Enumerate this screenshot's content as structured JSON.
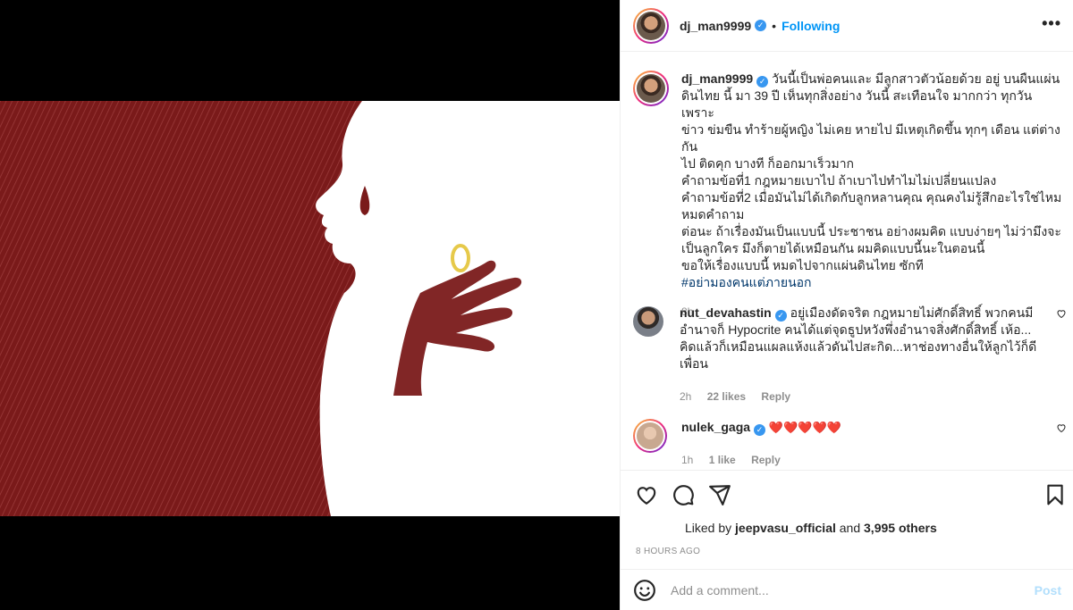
{
  "post": {
    "author": "dj_man9999",
    "follow_status": "Following",
    "more_icon": "more-options-icon",
    "caption": "วันนี้เป็นพ่อคนและ มีลูกสาวตัวน้อยด้วย อยู่ บนผืนแผ่น\nดินไทย นี้ มา 39 ปี เห็นทุกสิ่งอย่าง วันนี้ สะเทือนใจ มากกว่า ทุกวัน เพราะ\nข่าว ข่มขืน ทำร้ายผู้หญิง ไม่เคย หายไป มีเหตุเกิดขึ้น ทุกๆ เดือน แต่ต่างกัน\nไป ติดคุก บางที ก็ออกมาเร็วมาก\nคำถามข้อที่1 กฎหมายเบาไป ถ้าเบาไปทำไมไม่เปลี่ยนแปลง\nคำถามข้อที่2 เมื่อมันไม่ได้เกิดกับลูกหลานคุณ คุณคงไม่รู้สึกอะไรใช่ไหม\nหมดคำถาม\nต่อนะ ถ้าเรื่องมันเป็นแบบนี้ ประชาชน อย่างผมคิด แบบง่ายๆ ไม่ว่ามึงจะ\nเป็นลูกใคร มึงก็ตายได้เหมือนกัน ผมคิดแบบนี้นะในตอนนี้\nขอให้เรื่องแบบนี้ หมดไปจากแผ่นดินไทย ซักที",
    "hashtag": "#อย่ามองคนแต่ภายนอก",
    "caption_time": "8h"
  },
  "comments": [
    {
      "user": "nut_devahastin",
      "text": "อยู่เมืองดัดจริต กฎหมายไม่ศักดิ์สิทธิ์ พวกคนมี\nอำนาจก็ Hypocrite คนได้แต่จุดธูปหวังพึ่งอำนาจสิ่งศักดิ์สิทธิ์ เห้อ...\nคิดแล้วก็เหมือนแผลแห้งแล้วดันไปสะกิด...หาช่องทางอื่นให้ลูกไว้ก็ดี\nเพื่อน",
      "time": "2h",
      "likes": "22 likes",
      "reply": "Reply"
    },
    {
      "user": "nulek_gaga",
      "text": "❤️❤️❤️❤️❤️",
      "time": "1h",
      "likes": "1 like",
      "reply": "Reply"
    }
  ],
  "engagement": {
    "liked_by_prefix": "Liked by ",
    "liked_by_user": "jeepvasu_official",
    "liked_by_and": " and ",
    "liked_by_others": "3,995 others",
    "posted_ago": "8 HOURS AGO"
  },
  "composer": {
    "placeholder": "Add a comment...",
    "post_label": "Post"
  },
  "icons": {
    "like": "heart-icon",
    "comment": "comment-icon",
    "share": "share-icon",
    "save": "bookmark-icon",
    "emoji": "emoji-icon"
  },
  "colors": {
    "accent": "#0095f6",
    "artwork_background": "#7a1a1a",
    "ring": "#e6c94a"
  }
}
